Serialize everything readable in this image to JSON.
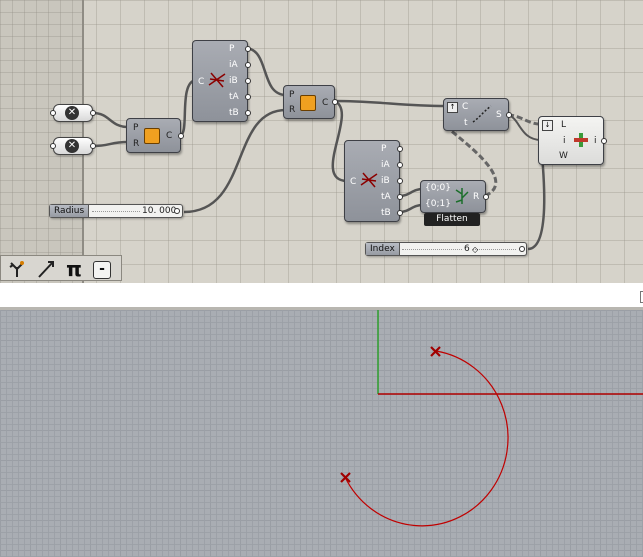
{
  "canvas": {
    "nodes": {
      "circle_cnr": {
        "inputs": [
          "P",
          "R"
        ],
        "output": "C"
      },
      "circle_cnr_2": {
        "inputs": [
          "P",
          "R"
        ],
        "output": "C"
      },
      "curve_curve_1": {
        "input": "C",
        "outputs": [
          "P",
          "iA",
          "iB",
          "tA",
          "tB"
        ]
      },
      "curve_curve_2": {
        "input": "C",
        "outputs": [
          "P",
          "iA",
          "iB",
          "tA",
          "tB"
        ]
      },
      "eval_curve": {
        "inputs": [
          "C",
          "t"
        ],
        "output": "S"
      },
      "flatten": {
        "inputs": [
          "{0;0}",
          "{0;1}"
        ],
        "output": "R",
        "tag": "Flatten"
      },
      "list_item": {
        "inputs": [
          "L",
          "i",
          "W"
        ],
        "output": "i"
      }
    },
    "sliders": {
      "radius": {
        "label": "Radius",
        "value": "10. 000"
      },
      "index": {
        "label": "Index",
        "value": "6"
      }
    },
    "params": [
      {
        "icon": "x-point-icon"
      },
      {
        "icon": "x-point-icon"
      }
    ]
  },
  "toolbar": {
    "items": [
      {
        "icon": "tree-icon"
      },
      {
        "icon": "arrow-pen-icon"
      },
      {
        "icon": "pi-icon",
        "label": "π"
      },
      {
        "icon": "minus-box-icon",
        "label": "-"
      }
    ]
  },
  "viewport": {
    "axis_colors": {
      "x": "#b00000",
      "y": "#2e9e2e"
    },
    "curve_color": "#c00000",
    "points": [
      {
        "icon": "x-marker-icon"
      },
      {
        "icon": "x-marker-icon"
      }
    ]
  }
}
